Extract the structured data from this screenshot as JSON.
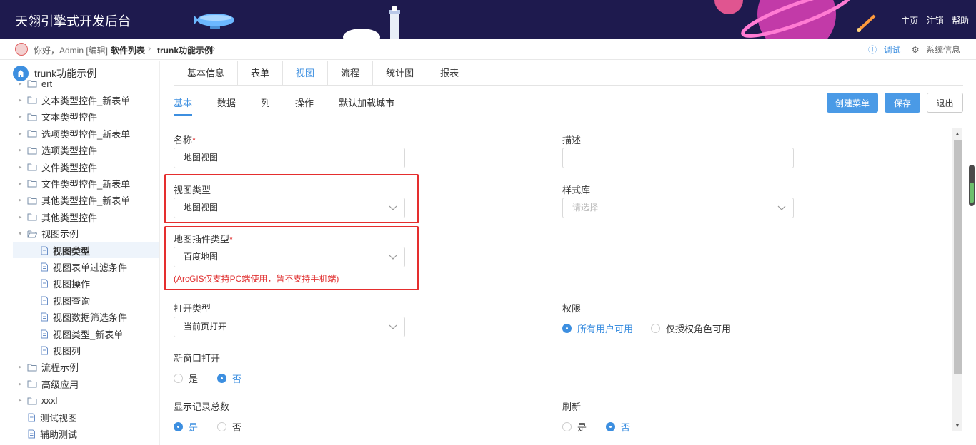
{
  "header": {
    "title": "天翎引擎式开发后台",
    "nav": [
      "主页",
      "注销",
      "帮助"
    ]
  },
  "crumbbar": {
    "greeting": "你好，Admin [编辑]",
    "crumbs": [
      "软件列表",
      "trunk功能示例"
    ],
    "debug": "调试",
    "system": "系统信息"
  },
  "sidebar": {
    "root": "trunk功能示例",
    "items": [
      {
        "label": "ert",
        "type": "folder",
        "level": 1
      },
      {
        "label": "文本类型控件_新表单",
        "type": "folder",
        "level": 1
      },
      {
        "label": "文本类型控件",
        "type": "folder",
        "level": 1
      },
      {
        "label": "选项类型控件_新表单",
        "type": "folder",
        "level": 1
      },
      {
        "label": "选项类型控件",
        "type": "folder",
        "level": 1
      },
      {
        "label": "文件类型控件",
        "type": "folder",
        "level": 1
      },
      {
        "label": "文件类型控件_新表单",
        "type": "folder",
        "level": 1
      },
      {
        "label": "其他类型控件_新表单",
        "type": "folder",
        "level": 1
      },
      {
        "label": "其他类型控件",
        "type": "folder",
        "level": 1
      },
      {
        "label": "视图示例",
        "type": "folder-open",
        "level": 1
      },
      {
        "label": "视图类型",
        "type": "file",
        "level": 2
      },
      {
        "label": "视图表单过滤条件",
        "type": "file",
        "level": 2
      },
      {
        "label": "视图操作",
        "type": "file",
        "level": 2
      },
      {
        "label": "视图查询",
        "type": "file",
        "level": 2
      },
      {
        "label": "视图数据筛选条件",
        "type": "file",
        "level": 2
      },
      {
        "label": "视图类型_新表单",
        "type": "file",
        "level": 2
      },
      {
        "label": "视图列",
        "type": "file",
        "level": 2
      },
      {
        "label": "流程示例",
        "type": "folder",
        "level": 1
      },
      {
        "label": "高级应用",
        "type": "folder",
        "level": 1
      },
      {
        "label": "xxxl",
        "type": "folder",
        "level": 1
      },
      {
        "label": "测试视图",
        "type": "file",
        "level": 1
      },
      {
        "label": "辅助测试",
        "type": "file",
        "level": 1
      }
    ]
  },
  "tabs_top": [
    "基本信息",
    "表单",
    "视图",
    "流程",
    "统计图",
    "报表"
  ],
  "tabs_sub": [
    "基本",
    "数据",
    "列",
    "操作",
    "默认加载城市"
  ],
  "buttons": {
    "create_menu": "创建菜单",
    "save": "保存",
    "exit": "退出"
  },
  "form": {
    "name_label": "名称",
    "name_value": "地图视图",
    "desc_label": "描述",
    "desc_value": "",
    "view_type_label": "视图类型",
    "view_type_value": "地图视图",
    "style_lib_label": "样式库",
    "style_lib_placeholder": "请选择",
    "map_plugin_label": "地图插件类型",
    "map_plugin_value": "百度地图",
    "map_plugin_hint": "(ArcGIS仅支持PC端使用，暂不支持手机端)",
    "open_type_label": "打开类型",
    "open_type_value": "当前页打开",
    "permission_label": "权限",
    "permission_options": [
      "所有用户可用",
      "仅授权角色可用"
    ],
    "new_window_label": "新窗口打开",
    "new_window_options": [
      "是",
      "否"
    ],
    "show_total_label": "显示记录总数",
    "show_total_options": [
      "是",
      "否"
    ],
    "refresh_label": "刷新",
    "refresh_options": [
      "是",
      "否"
    ]
  }
}
